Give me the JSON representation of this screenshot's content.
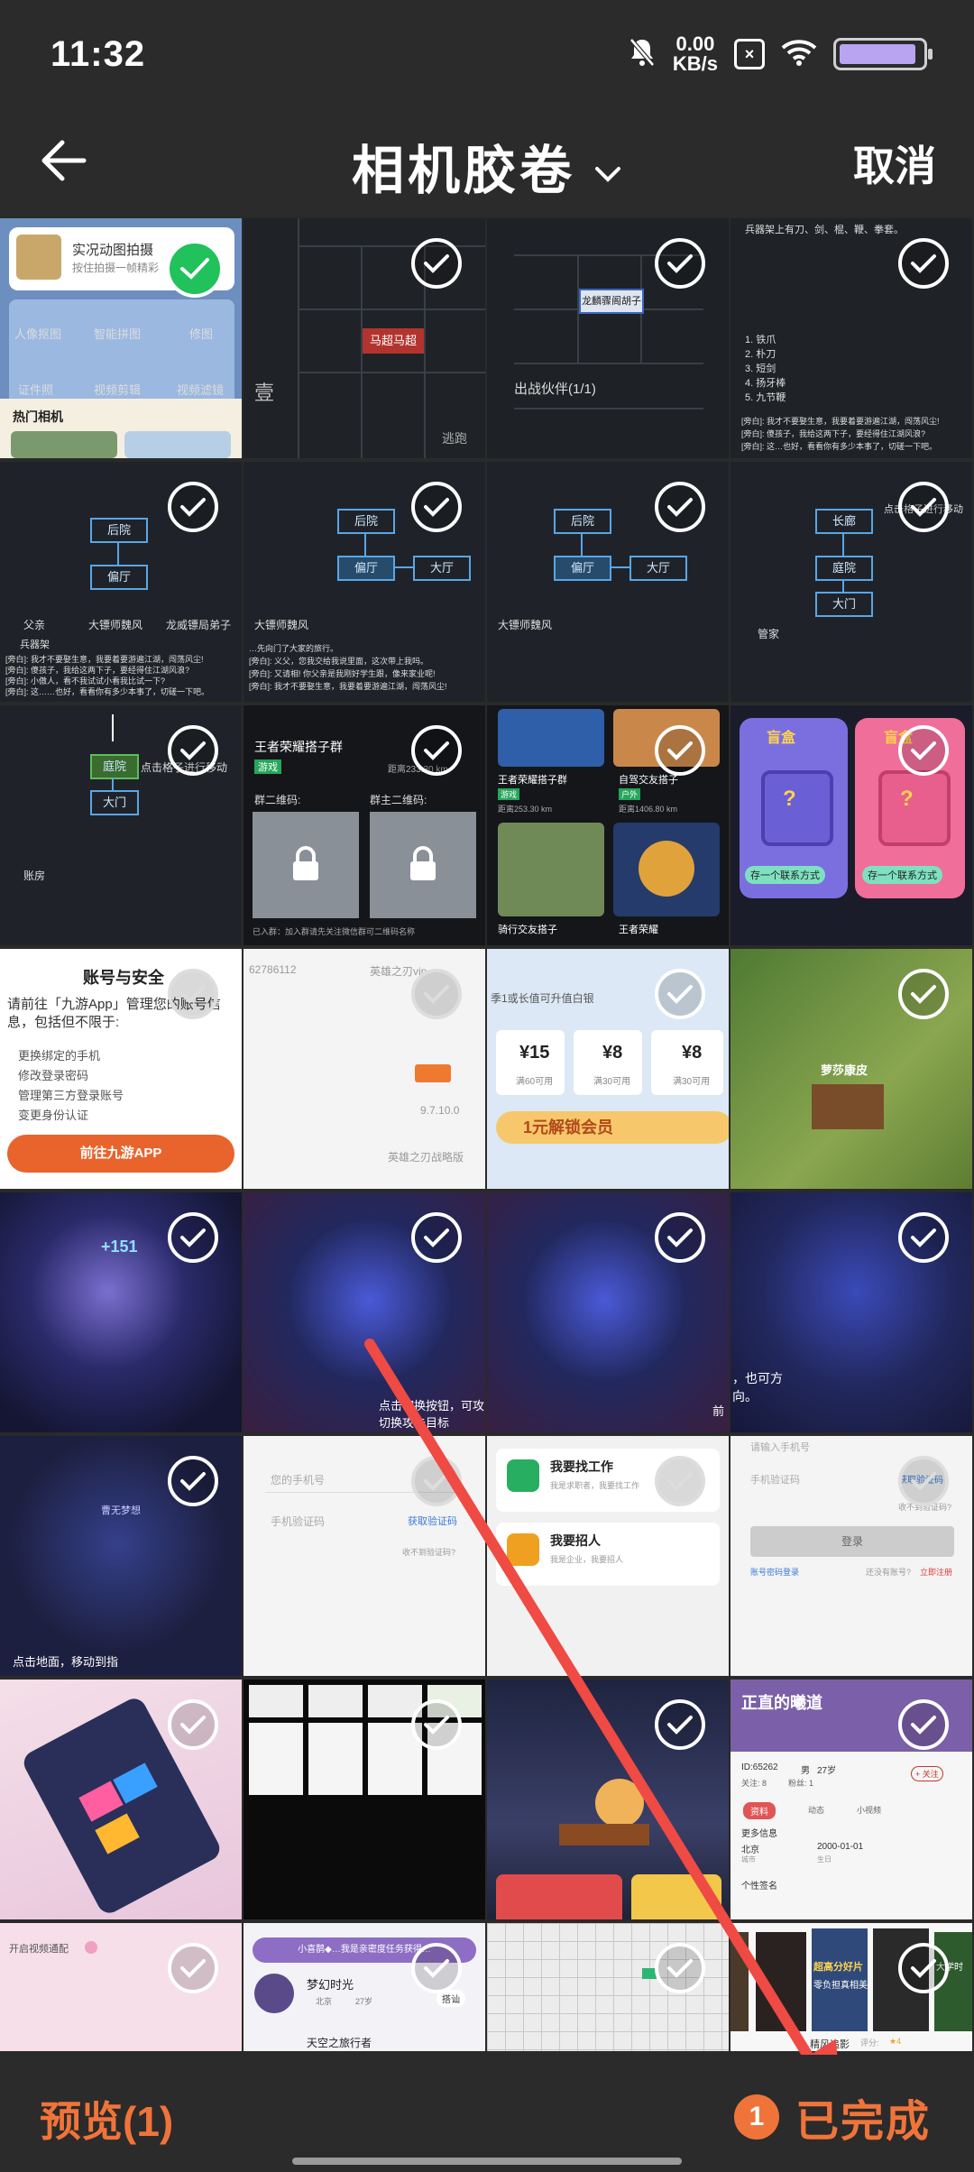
{
  "status": {
    "time": "11:32",
    "net_speed_value": "0.00",
    "net_speed_unit": "KB/s",
    "sim_label": "×"
  },
  "header": {
    "title": "相机胶卷",
    "cancel_label": "取消"
  },
  "footer": {
    "preview_label": "预览(1)",
    "selected_count": "1",
    "done_label": "已完成"
  },
  "thumbs": {
    "c1": {
      "title": "实况动图拍摄",
      "sub": "按住拍摄一帧精彩",
      "items": [
        "人像抠图",
        "智能拼图",
        "修图",
        "证件照",
        "视频剪辑",
        "视频滤镜"
      ],
      "section": "热门相机"
    },
    "c2": {
      "sign": "马超马超",
      "corner": "逃跑",
      "badge": "壹"
    },
    "c3": {
      "card": "龙麟骤阁胡子",
      "label": "出战伙伴(1/1)"
    },
    "c4": {
      "lines": [
        "兵器架上有刀、剑、棍、鞭、拳套。",
        "1. 铁爪",
        "2. 朴刀",
        "3. 短剑",
        "4. 扬牙棒",
        "5. 九节鞭",
        "[旁白]: 我才不要娶生意，我要着要游遍江湖，闯荡风尘!",
        "[旁白]: 傻孩子，我给这两下子，要经得住江湖风浪?",
        "[旁白]: 这…也好，看看你有多少本事了，切磋一下吧。"
      ]
    },
    "c5": {
      "boxes": [
        "后院",
        "偏厅"
      ],
      "foot": [
        "父亲",
        "大镖师魏风",
        "龙威镖局弟子"
      ],
      "sub": "兵器架",
      "dlg": [
        "[旁白]: 我才不要娶生意，我要着要游遍江湖，闯荡风尘!",
        "[旁白]: 傻孩子，我给这两下子，要经得住江湖风浪?",
        "[旁白]: 小傲人，看不我试试小看我比试一下?",
        "[旁白]: 这……也好，看看你有多少本事了，切磋一下吧。"
      ]
    },
    "c6": {
      "boxes": [
        "后院",
        "偏厅",
        "大厅"
      ],
      "foot": "大镖师魏风",
      "dlg": [
        "…先向门了大家的旅行。",
        "[旁白]: 义父，您我交给我说里面，这次带上我吗。",
        "[旁白]: 又请相! 你父亲是我刚好学生跟，像来家业呢!",
        "[旁白]: 我才不要娶生意，我要着要游遍江湖，闯荡风尘!"
      ]
    },
    "c7": {
      "boxes": [
        "后院",
        "偏厅",
        "大厅"
      ],
      "foot": "大镖师魏风"
    },
    "c8": {
      "boxes": [
        "长廊",
        "庭院",
        "大门"
      ],
      "tag": "点击格子进行移动",
      "foot": "管家"
    },
    "c9": {
      "boxes": [
        "庭院",
        "大门"
      ],
      "tag": "点击格子进行移动",
      "foot": "账房"
    },
    "c10": {
      "title": "王者荣耀搭子群",
      "tag": "游戏",
      "dist": "距离233.30 km",
      "qr1": "群二维码:",
      "qr2": "群主二维码:",
      "note": "已入群：加入群请先关注微信群可二维码名称"
    },
    "c11": {
      "t1": "王者荣耀搭子群",
      "tag1": "游戏",
      "d1": "距离253.30 km",
      "t2": "自驾交友搭子",
      "tag2": "户外",
      "d2": "距离1406.80 km",
      "t3": "骑行交友搭子",
      "t4": "王者荣耀"
    },
    "c12": {
      "label": "存一个联系方式",
      "label2": "存一个联系方式",
      "box1": "盲盒",
      "box2": "盲盒"
    },
    "c13": {
      "title": "账号与安全",
      "desc": "请前往「九游App」管理您的账号信息，包括但不限于:",
      "items": [
        "更换绑定的手机",
        "修改登录密码",
        "管理第三方登录账号",
        "变更身份认证"
      ],
      "button": "前往九游APP"
    },
    "c14": {
      "id": "62786112",
      "game": "英雄之刃vip",
      "version": "9.7.10.0",
      "footer": "英雄之刃战略版"
    },
    "c15": {
      "top": "季1或长值可升值白银",
      "prices": [
        "¥15",
        "¥8",
        "¥8"
      ],
      "subs": [
        "满60可用",
        "满30可用",
        "满30可用"
      ],
      "cta": "1元解锁会员"
    },
    "c16": {
      "name": "萝莎康皮"
    },
    "c17": {
      "num": "+151"
    },
    "c18": {
      "tip": "点击切换按钮，可攻切换攻击目标"
    },
    "c19": {
      "tip": "前"
    },
    "c20": {
      "tip": "，也可方向。"
    },
    "c21": {
      "name": "曹无梦想",
      "tip": "点击地面，移动到指"
    },
    "c22": {
      "ph1": "您的手机号",
      "ph2": "手机验证码",
      "link": "获取验证码",
      "hint": "收不到验证码?"
    },
    "c23": {
      "a": "我要找工作",
      "a_sub": "我是求职者，我要找工作",
      "b": "我要招人",
      "b_sub": "我是企业，我要招人"
    },
    "c24": {
      "ph1": "请输入手机号",
      "ph2": "手机验证码",
      "link": "获取验证码",
      "hint": "收不到验证码?",
      "btn": "登录",
      "l1": "账号密码登录",
      "l2": "还没有账号?",
      "l3": "立即注册"
    },
    "c25": {},
    "c26": {},
    "c27": {},
    "c28": {
      "banner": "正直的曦道",
      "id": "ID:65262",
      "gender": "男",
      "age": "27岁",
      "follow": "关注: 8",
      "fans": "粉丝: 1",
      "btn": "+ 关注",
      "tabs": [
        "资料",
        "动态",
        "小视频"
      ],
      "sec": "更多信息",
      "city": "北京",
      "date": "2000-01-01",
      "l1": "城市",
      "l2": "生日",
      "sign": "个性签名"
    },
    "c29": {
      "text": "开启视频通配"
    },
    "c30": {
      "banner": "小喜鹊◆…我是亲密度任务获得…",
      "name": "梦幻时光",
      "city": "北京",
      "age": "27岁",
      "btn": "搭讪",
      "next": "天空之旅行者"
    },
    "c31": {},
    "c32": {
      "caption": "精风追影",
      "score": "评分:",
      "stars": "★4",
      "p1": "超高分好片",
      "p2": "零负担真相美",
      "p3": "大学时"
    }
  }
}
